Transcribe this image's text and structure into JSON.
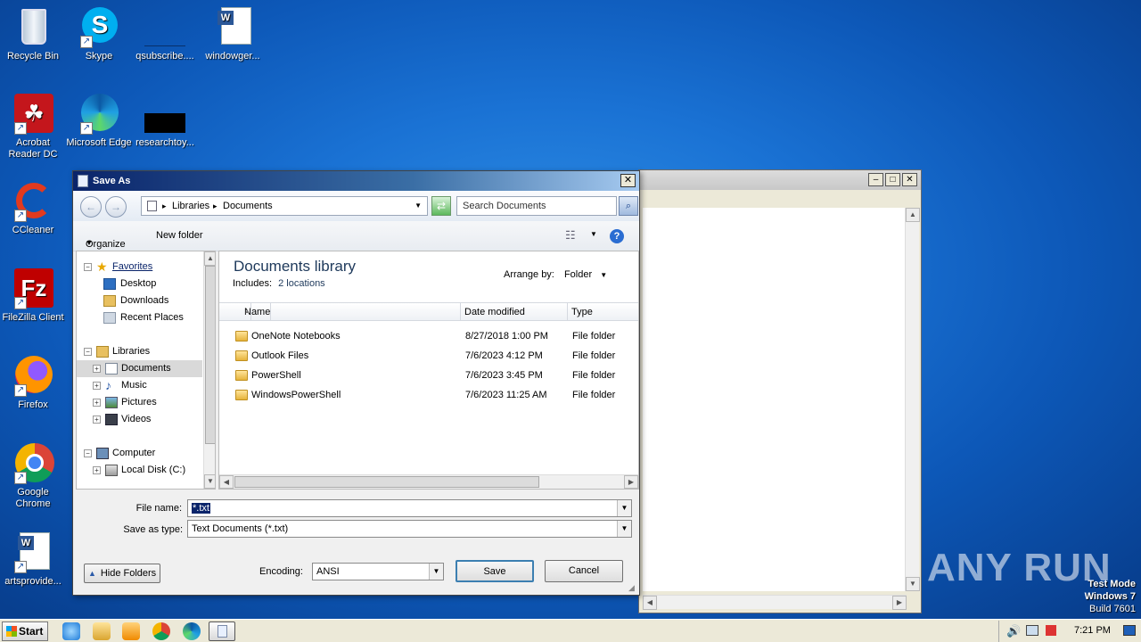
{
  "desktop": {
    "icons": [
      {
        "label": "Recycle Bin"
      },
      {
        "label": "Skype"
      },
      {
        "label": "qsubscribe...."
      },
      {
        "label": "windowger..."
      },
      {
        "label": "Acrobat Reader DC"
      },
      {
        "label": "Microsoft Edge"
      },
      {
        "label": "researchtoy..."
      },
      {
        "label": "CCleaner"
      },
      {
        "label": "FileZilla Client"
      },
      {
        "label": "Firefox"
      },
      {
        "label": "Google Chrome"
      },
      {
        "label": "artsprovide..."
      }
    ],
    "watermark": "ANY RUN",
    "test_mode": {
      "line1": "Test Mode",
      "line2": "Windows 7",
      "line3": "Build 7601"
    }
  },
  "dialog": {
    "title": "Save As",
    "close_glyph": "✕",
    "breadcrumb": {
      "sep": "▸",
      "part1": "Libraries",
      "part2": "Documents"
    },
    "search_placeholder": "Search Documents",
    "toolbar": {
      "organize": "Organize",
      "new_folder": "New folder"
    },
    "nav_tree": {
      "favorites": "Favorites",
      "desktop": "Desktop",
      "downloads": "Downloads",
      "recent_places": "Recent Places",
      "libraries": "Libraries",
      "documents": "Documents",
      "music": "Music",
      "pictures": "Pictures",
      "videos": "Videos",
      "computer": "Computer",
      "local_disk": "Local Disk (C:)"
    },
    "library": {
      "title": "Documents library",
      "includes_label": "Includes:",
      "includes_value": "2 locations",
      "arrange_label": "Arrange by:",
      "arrange_value": "Folder"
    },
    "columns": {
      "name": "Name",
      "date": "Date modified",
      "type": "Type"
    },
    "files": [
      {
        "name": "OneNote Notebooks",
        "date": "8/27/2018 1:00 PM",
        "type": "File folder"
      },
      {
        "name": "Outlook Files",
        "date": "7/6/2023 4:12 PM",
        "type": "File folder"
      },
      {
        "name": "PowerShell",
        "date": "7/6/2023 3:45 PM",
        "type": "File folder"
      },
      {
        "name": "WindowsPowerShell",
        "date": "7/6/2023 11:25 AM",
        "type": "File folder"
      }
    ],
    "file_name_label": "File name:",
    "file_name_value": "*.txt",
    "save_type_label": "Save as type:",
    "save_type_value": "Text Documents (*.txt)",
    "hide_folders": "Hide Folders",
    "encoding_label": "Encoding:",
    "encoding_value": "ANSI",
    "save_button": "Save",
    "cancel_button": "Cancel"
  },
  "taskbar": {
    "start": "Start",
    "clock": "7:21 PM"
  }
}
